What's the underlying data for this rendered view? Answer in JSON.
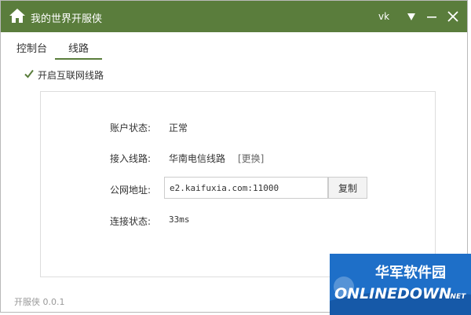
{
  "app": {
    "title": "我的世界开服侠",
    "user": "vk"
  },
  "tabs": [
    {
      "label": "控制台"
    },
    {
      "label": "线路"
    }
  ],
  "active_tab": "线路",
  "checkbox": {
    "label": "开启互联网线路",
    "checked": true
  },
  "panel": {
    "account_status_label": "账户状态:",
    "account_status_value": "正常",
    "route_label": "接入线路:",
    "route_value": "华南电信线路",
    "change_label": "[更换]",
    "address_label": "公网地址:",
    "address_value": "e2.kaifuxia.com:11000",
    "copy_label": "复制",
    "connection_label": "连接状态:",
    "connection_value": "33ms"
  },
  "footer": {
    "version": "开服侠 0.0.1"
  },
  "watermark": {
    "cn_text": "华军软件园",
    "en_text": "ONLINEDOWN",
    "suffix": ".NET"
  },
  "colors": {
    "titlebar": "#5a7d3c",
    "accent": "#5a7d3c",
    "watermark_blue": "#1e6fc8"
  },
  "icons": {
    "home": "home-icon",
    "dropdown": "triangle-down-icon",
    "minimize": "minimize-icon",
    "close": "close-icon",
    "check": "checkmark-icon"
  }
}
